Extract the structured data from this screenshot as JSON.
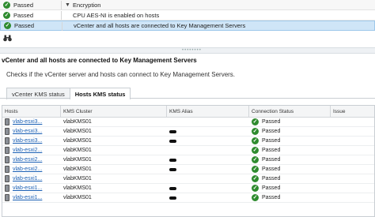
{
  "top_rows": [
    {
      "status": "Passed",
      "desc": "Encryption",
      "expand": "▼"
    },
    {
      "status": "Passed",
      "desc": "CPU AES-NI is enabled on hosts"
    },
    {
      "status": "Passed",
      "desc": "vCenter and all hosts are connected to Key Management Servers",
      "selected": true
    }
  ],
  "toolbar": {
    "icon": "binoculars-icon"
  },
  "detail": {
    "title": "vCenter and all hosts are connected to Key Management Servers",
    "description": "Checks if the vCenter server and hosts can connect to Key Management Servers."
  },
  "tabs": [
    {
      "label": "vCenter KMS status",
      "active": false
    },
    {
      "label": "Hosts KMS status",
      "active": true
    }
  ],
  "grid": {
    "headers": [
      "Hosts",
      "KMS Cluster",
      "KMS Alias",
      "Connection Status",
      "Issue"
    ],
    "rows": [
      {
        "host": "vlab-esxi3...",
        "cluster": "vlabKMS01",
        "alias_redacted": false,
        "status": "Passed"
      },
      {
        "host": "vlab-esxi3...",
        "cluster": "vlabKMS01",
        "alias_redacted": true,
        "status": "Passed"
      },
      {
        "host": "vlab-esxi3...",
        "cluster": "vlabKMS01",
        "alias_redacted": true,
        "status": "Passed"
      },
      {
        "host": "vlab-esxi2...",
        "cluster": "vlabKMS01",
        "alias_redacted": false,
        "status": "Passed"
      },
      {
        "host": "vlab-esxi2...",
        "cluster": "vlabKMS01",
        "alias_redacted": true,
        "status": "Passed"
      },
      {
        "host": "vlab-esxi2...",
        "cluster": "vlabKMS01",
        "alias_redacted": true,
        "status": "Passed"
      },
      {
        "host": "vlab-esxi1...",
        "cluster": "vlabKMS01",
        "alias_redacted": false,
        "status": "Passed"
      },
      {
        "host": "vlab-esxi1...",
        "cluster": "vlabKMS01",
        "alias_redacted": true,
        "status": "Passed"
      },
      {
        "host": "vlab-esxi1...",
        "cluster": "vlabKMS01",
        "alias_redacted": true,
        "status": "Passed"
      }
    ]
  },
  "colors": {
    "passed": "#2e8b2e",
    "selected_row": "#cfe5f7",
    "link": "#1a5fb4"
  }
}
